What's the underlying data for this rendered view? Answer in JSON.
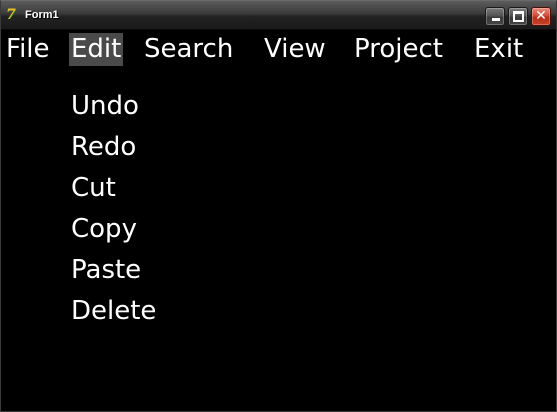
{
  "window": {
    "title": "Form1",
    "app_icon": "delphi-icon",
    "controls": {
      "minimize_icon": "minimize-icon",
      "maximize_icon": "maximize-icon",
      "close_icon": "close-icon",
      "close_glyph": "✕"
    }
  },
  "menubar": {
    "items": [
      {
        "label": "File"
      },
      {
        "label": "Edit"
      },
      {
        "label": "Search"
      },
      {
        "label": "View"
      },
      {
        "label": "Project"
      },
      {
        "label": "Exit"
      }
    ],
    "active": "Edit"
  },
  "edit_menu": {
    "items": [
      {
        "label": "Undo"
      },
      {
        "label": "Redo"
      },
      {
        "label": "Cut"
      },
      {
        "label": "Copy"
      },
      {
        "label": "Paste"
      },
      {
        "label": "Delete"
      }
    ]
  },
  "colors": {
    "background": "#000000",
    "text": "#ffffff",
    "active_menu_bg": "#4a4a4a",
    "close_button": "#c8402a"
  }
}
